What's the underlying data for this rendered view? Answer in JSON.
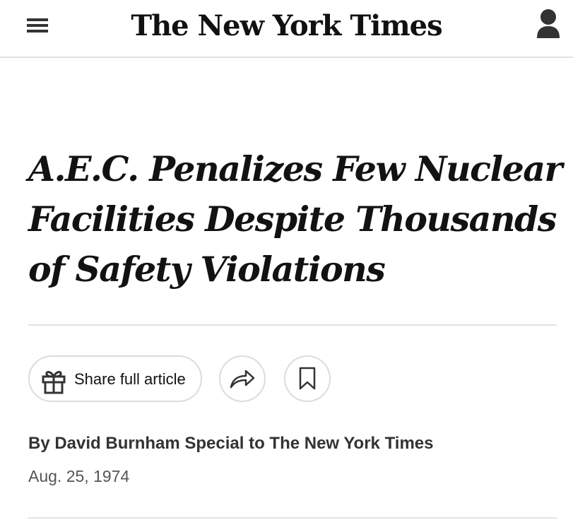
{
  "header": {
    "masthead": "The New York Times",
    "menu_icon": "hamburger-menu-icon",
    "account_icon": "person-icon"
  },
  "article": {
    "headline": "A.E.C. Penalizes Few Nuclear Facilities Despite Thousands of Safety Violations",
    "byline": "By David Burnham Special to The New York Times",
    "date": "Aug. 25, 1974"
  },
  "toolbar": {
    "share_full_article_label": "Share full article",
    "gift_icon": "gift-icon",
    "share_icon": "share-arrow-icon",
    "save_icon": "bookmark-icon"
  },
  "colors": {
    "text": "#121212",
    "border": "#dcdcdc",
    "divider": "#e2e2e2",
    "secondary_text": "#555555"
  }
}
